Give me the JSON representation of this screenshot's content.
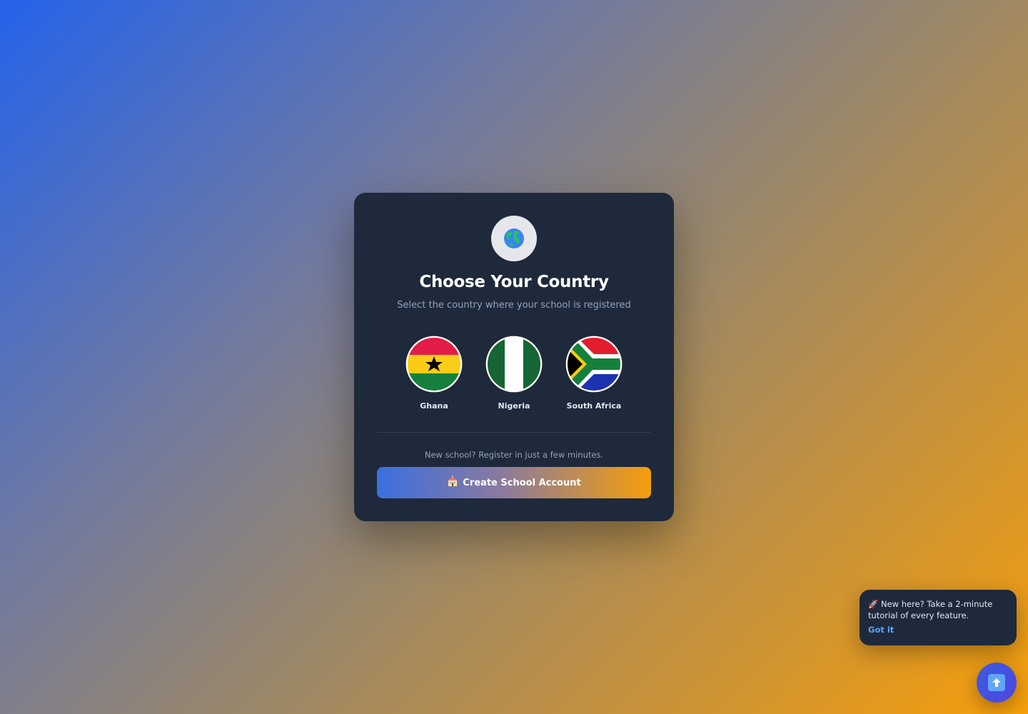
{
  "card": {
    "icon": "globe-icon",
    "title": "Choose Your Country",
    "subtitle": "Select the country where your school is registered"
  },
  "countries": [
    {
      "name": "Ghana",
      "icon": "ghana-flag-icon"
    },
    {
      "name": "Nigeria",
      "icon": "nigeria-flag-icon"
    },
    {
      "name": "South Africa",
      "icon": "south-africa-flag-icon"
    }
  ],
  "register": {
    "prompt": "New school? Register in just a few minutes.",
    "button_label": "Create School Account",
    "button_icon": "school-icon"
  },
  "toast": {
    "icon": "rocket-icon",
    "message": "New here? Take a 2-minute tutorial of every feature.",
    "action_label": "Got it"
  },
  "fab": {
    "icon": "arrow-up-icon"
  },
  "colors": {
    "card_bg": "#1e293b",
    "accent_blue": "#2563eb",
    "accent_orange": "#f59e0b",
    "link": "#60a5fa"
  }
}
